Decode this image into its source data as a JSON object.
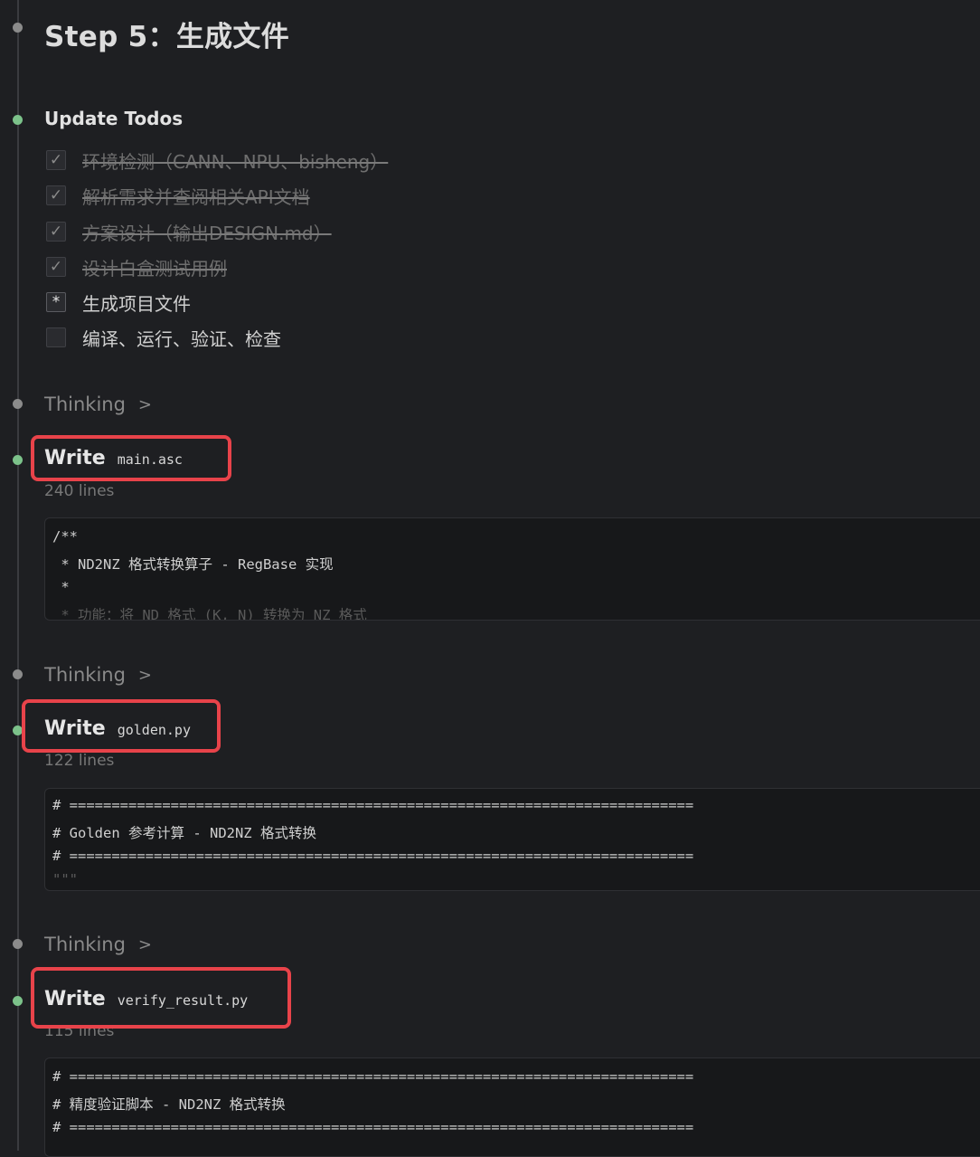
{
  "title": "Step 5：生成文件",
  "todos": {
    "heading": "Update Todos",
    "items": [
      {
        "label": "环境检测（CANN、NPU、bisheng）",
        "mark": "✓",
        "state": "done"
      },
      {
        "label": "解析需求并查阅相关API文档",
        "mark": "✓",
        "state": "done"
      },
      {
        "label": "方案设计（输出DESIGN.md）",
        "mark": "✓",
        "state": "done"
      },
      {
        "label": "设计白盒测试用例",
        "mark": "✓",
        "state": "done"
      },
      {
        "label": "生成项目文件",
        "mark": "*",
        "state": "in-progress"
      },
      {
        "label": "编译、运行、验证、检查",
        "mark": "",
        "state": "pending"
      }
    ]
  },
  "thinking_label": "Thinking",
  "writes": [
    {
      "label": "Write",
      "file": "main.asc",
      "lines": "240 lines",
      "code": [
        "/**",
        " * ND2NZ 格式转换算子 - RegBase 实现",
        " *",
        " * 功能：将 ND 格式 (K, N) 转换为 NZ 格式"
      ]
    },
    {
      "label": "Write",
      "file": "golden.py",
      "lines": "122 lines",
      "code": [
        "# ==========================================================================",
        "# Golden 参考计算 - ND2NZ 格式转换",
        "# ==========================================================================",
        "\"\"\""
      ]
    },
    {
      "label": "Write",
      "file": "verify_result.py",
      "lines": "115 lines",
      "code": [
        "# ==========================================================================",
        "# 精度验证脚本 - ND2NZ 格式转换",
        "# ==========================================================================",
        ""
      ]
    }
  ],
  "colors": {
    "background": "#1e1f22",
    "highlight": "#e8434a",
    "status_done_dot": "#7cc28a",
    "status_idle_dot": "#8b8b8b"
  }
}
